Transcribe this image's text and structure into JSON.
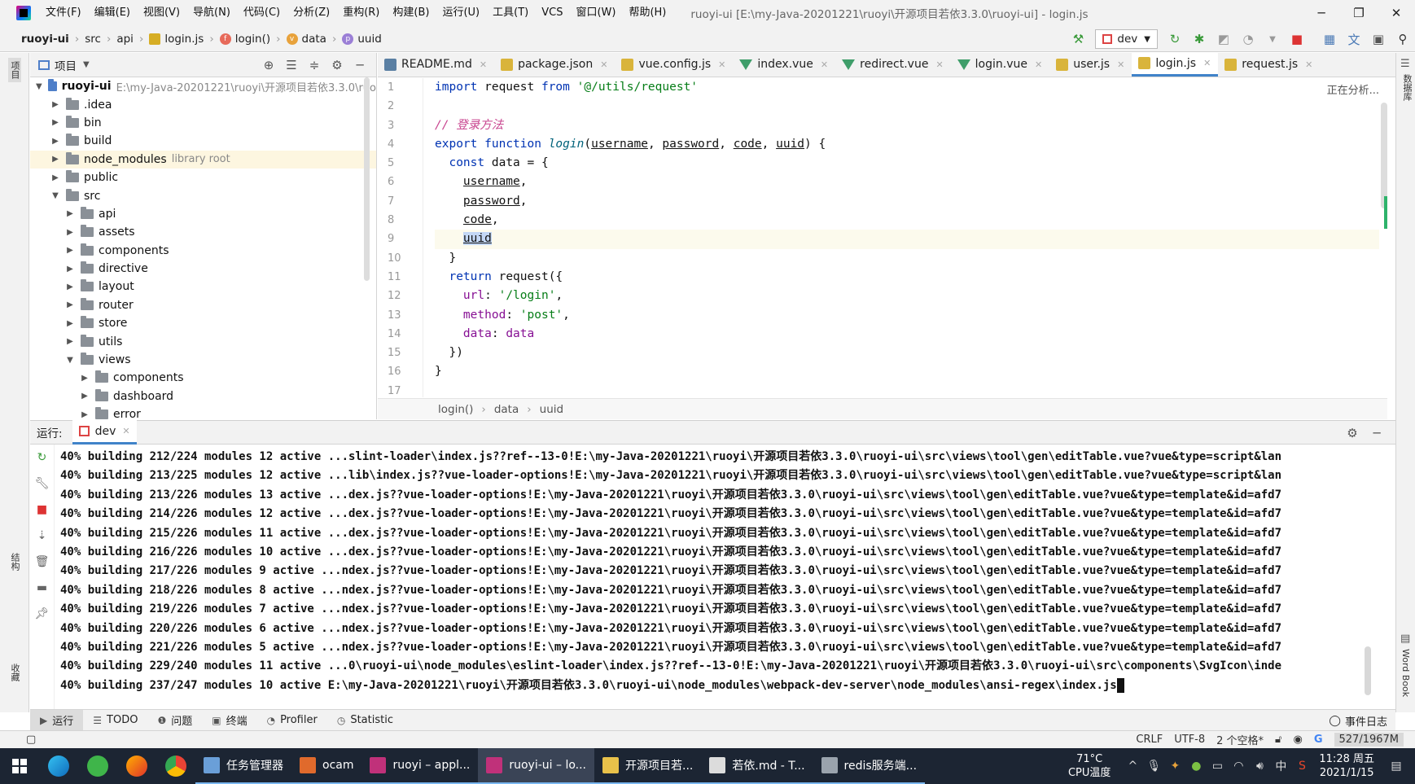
{
  "menubar": {
    "items": [
      "文件(F)",
      "编辑(E)",
      "视图(V)",
      "导航(N)",
      "代码(C)",
      "分析(Z)",
      "重构(R)",
      "构建(B)",
      "运行(U)",
      "工具(T)",
      "VCS",
      "窗口(W)",
      "帮助(H)"
    ],
    "title": "ruoyi-ui [E:\\my-Java-20201221\\ruoyi\\开源项目若依3.3.0\\ruoyi-ui] - login.js",
    "minimize": "─",
    "maximize": "❐",
    "close": "✕"
  },
  "navbar": {
    "crumbs": [
      "ruoyi-ui",
      "src",
      "api",
      "login.js",
      "login()",
      "data",
      "uuid"
    ],
    "run_config": "dev"
  },
  "left_strip": {
    "project_label": "项目",
    "structure_label": "结构",
    "favorites_label": "收藏"
  },
  "project_panel": {
    "title": "项目",
    "root": {
      "name": "ruoyi-ui",
      "path": "E:\\my-Java-20201221\\ruoyi\\开源项目若依3.3.0\\ruo"
    },
    "rows": [
      {
        "name": ".idea",
        "depth": 1,
        "open": false
      },
      {
        "name": "bin",
        "depth": 1,
        "open": false
      },
      {
        "name": "build",
        "depth": 1,
        "open": false
      },
      {
        "name": "node_modules",
        "depth": 1,
        "open": false,
        "note": "library root"
      },
      {
        "name": "public",
        "depth": 1,
        "open": false
      },
      {
        "name": "src",
        "depth": 1,
        "open": true
      },
      {
        "name": "api",
        "depth": 2,
        "open": false
      },
      {
        "name": "assets",
        "depth": 2,
        "open": false
      },
      {
        "name": "components",
        "depth": 2,
        "open": false
      },
      {
        "name": "directive",
        "depth": 2,
        "open": false
      },
      {
        "name": "layout",
        "depth": 2,
        "open": false
      },
      {
        "name": "router",
        "depth": 2,
        "open": false
      },
      {
        "name": "store",
        "depth": 2,
        "open": false
      },
      {
        "name": "utils",
        "depth": 2,
        "open": false
      },
      {
        "name": "views",
        "depth": 2,
        "open": true
      },
      {
        "name": "components",
        "depth": 3,
        "open": false
      },
      {
        "name": "dashboard",
        "depth": 3,
        "open": false
      },
      {
        "name": "error",
        "depth": 3,
        "open": false
      }
    ]
  },
  "editor": {
    "tabs": [
      {
        "label": "README.md",
        "icon": "md"
      },
      {
        "label": "package.json",
        "icon": "json"
      },
      {
        "label": "vue.config.js",
        "icon": "js"
      },
      {
        "label": "index.vue",
        "icon": "vue"
      },
      {
        "label": "redirect.vue",
        "icon": "vue"
      },
      {
        "label": "login.vue",
        "icon": "vue"
      },
      {
        "label": "user.js",
        "icon": "js"
      },
      {
        "label": "login.js",
        "icon": "js",
        "active": true
      },
      {
        "label": "request.js",
        "icon": "js"
      }
    ],
    "analysis_status": "正在分析...",
    "code": [
      "import request from '@/utils/request'",
      "",
      "// 登录方法",
      "export function login(username, password, code, uuid) {",
      "  const data = {",
      "    username,",
      "    password,",
      "    code,",
      "    uuid",
      "  }",
      "  return request({",
      "    url: '/login',",
      "    method: 'post',",
      "    data: data",
      "  })",
      "}",
      ""
    ],
    "breadcrumb": [
      "login()",
      "data",
      "uuid"
    ]
  },
  "run_panel": {
    "label": "运行:",
    "tab": "dev",
    "console": [
      "40% building 212/224 modules 12 active ...slint-loader\\index.js??ref--13-0!E:\\my-Java-20201221\\ruoyi\\开源项目若依3.3.0\\ruoyi-ui\\src\\views\\tool\\gen\\editTable.vue?vue&type=script&lan",
      "40% building 213/225 modules 12 active ...lib\\index.js??vue-loader-options!E:\\my-Java-20201221\\ruoyi\\开源项目若依3.3.0\\ruoyi-ui\\src\\views\\tool\\gen\\editTable.vue?vue&type=script&lan",
      "40% building 213/226 modules 13 active ...dex.js??vue-loader-options!E:\\my-Java-20201221\\ruoyi\\开源项目若依3.3.0\\ruoyi-ui\\src\\views\\tool\\gen\\editTable.vue?vue&type=template&id=afd7",
      "40% building 214/226 modules 12 active ...dex.js??vue-loader-options!E:\\my-Java-20201221\\ruoyi\\开源项目若依3.3.0\\ruoyi-ui\\src\\views\\tool\\gen\\editTable.vue?vue&type=template&id=afd7",
      "40% building 215/226 modules 11 active ...dex.js??vue-loader-options!E:\\my-Java-20201221\\ruoyi\\开源项目若依3.3.0\\ruoyi-ui\\src\\views\\tool\\gen\\editTable.vue?vue&type=template&id=afd7",
      "40% building 216/226 modules 10 active ...dex.js??vue-loader-options!E:\\my-Java-20201221\\ruoyi\\开源项目若依3.3.0\\ruoyi-ui\\src\\views\\tool\\gen\\editTable.vue?vue&type=template&id=afd7",
      "40% building 217/226 modules 9 active ...ndex.js??vue-loader-options!E:\\my-Java-20201221\\ruoyi\\开源项目若依3.3.0\\ruoyi-ui\\src\\views\\tool\\gen\\editTable.vue?vue&type=template&id=afd7",
      "40% building 218/226 modules 8 active ...ndex.js??vue-loader-options!E:\\my-Java-20201221\\ruoyi\\开源项目若依3.3.0\\ruoyi-ui\\src\\views\\tool\\gen\\editTable.vue?vue&type=template&id=afd7",
      "40% building 219/226 modules 7 active ...ndex.js??vue-loader-options!E:\\my-Java-20201221\\ruoyi\\开源项目若依3.3.0\\ruoyi-ui\\src\\views\\tool\\gen\\editTable.vue?vue&type=template&id=afd7",
      "40% building 220/226 modules 6 active ...ndex.js??vue-loader-options!E:\\my-Java-20201221\\ruoyi\\开源项目若依3.3.0\\ruoyi-ui\\src\\views\\tool\\gen\\editTable.vue?vue&type=template&id=afd7",
      "40% building 221/226 modules 5 active ...ndex.js??vue-loader-options!E:\\my-Java-20201221\\ruoyi\\开源项目若依3.3.0\\ruoyi-ui\\src\\views\\tool\\gen\\editTable.vue?vue&type=template&id=afd7",
      "40% building 229/240 modules 11 active ...0\\ruoyi-ui\\node_modules\\eslint-loader\\index.js??ref--13-0!E:\\my-Java-20201221\\ruoyi\\开源项目若依3.3.0\\ruoyi-ui\\src\\components\\SvgIcon\\inde",
      "40% building 237/247 modules 10 active E:\\my-Java-20201221\\ruoyi\\开源项目若依3.3.0\\ruoyi-ui\\node_modules\\webpack-dev-server\\node_modules\\ansi-regex\\index.js"
    ]
  },
  "right_strip": {
    "database_label": "数据库",
    "wordbook_label": "Word Book"
  },
  "bottom_tabs": [
    "运行",
    "TODO",
    "问题",
    "终端",
    "Profiler",
    "Statistic"
  ],
  "event_log": "事件日志",
  "statusbar": {
    "line_sep": "CRLF",
    "encoding": "UTF-8",
    "indent": "2 个空格*",
    "memory": "527/1967M"
  },
  "taskbar": {
    "apps": [
      {
        "label": "任务管理器",
        "color": "#6a9fd8"
      },
      {
        "label": "ocam",
        "color": "#e06a2c"
      },
      {
        "label": "ruoyi – appl...",
        "color": "#c0317a"
      },
      {
        "label": "ruoyi-ui – lo...",
        "color": "#c0317a",
        "active": true
      },
      {
        "label": "开源项目若...",
        "color": "#e8c14a"
      },
      {
        "label": "若依.md - T...",
        "color": "#dcdcdc"
      },
      {
        "label": "redis服务端...",
        "color": "#9aa3ad"
      }
    ],
    "temp": "71°C",
    "temp_label": "CPU温度",
    "ime": "中",
    "time": "11:28 周五",
    "date": "2021/1/15"
  }
}
